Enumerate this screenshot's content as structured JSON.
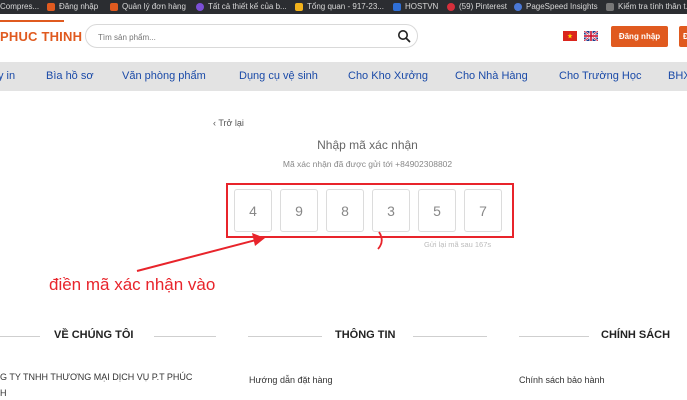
{
  "bookmarks": [
    {
      "label": "Compres...",
      "color": "#555555"
    },
    {
      "label": "Đăng nhập",
      "color": "#e05a1f"
    },
    {
      "label": "Quản lý đơn hàng",
      "color": "#e05a1f"
    },
    {
      "label": "Tất cả thiết kế của b...",
      "color": "#7b4fd6"
    },
    {
      "label": "Tổng quan - 917-23...",
      "color": "#f2b21b"
    },
    {
      "label": "HOSTVN",
      "color": "#2f6fd6"
    },
    {
      "label": "(59) Pinterest",
      "color": "#d62f3b"
    },
    {
      "label": "PageSpeed Insights",
      "color": "#4a78d6"
    },
    {
      "label": "Kiểm tra tính thân t...",
      "color": "#333333"
    }
  ],
  "header": {
    "logo": "PHUC THINH",
    "search_placeholder": "Tìm sản phẩm...",
    "login_label": "Đăng nhập",
    "login_label_2": "Đ",
    "accent": "#e05a1f"
  },
  "nav": {
    "items": [
      "y in",
      "Bìa hồ sơ",
      "Văn phòng phẩm",
      "Dụng cụ vệ sinh",
      "Cho Kho Xưởng",
      "Cho Nhà Hàng",
      "Cho Trường Học",
      "BHX"
    ]
  },
  "otp": {
    "back_label": "Trở lại",
    "title": "Nhập mã xác nhận",
    "subtitle": "Mã xác nhận đã được gửi tới +84902308802",
    "digits": [
      "4",
      "9",
      "8",
      "3",
      "5",
      "7"
    ],
    "resend": "Gửi lại mã sau 167s"
  },
  "annotation": {
    "text": "điền mã xác nhận vào",
    "color": "#e8242b"
  },
  "footer": {
    "sections": [
      "VỀ CHÚNG TÔI",
      "THÔNG TIN",
      "CHÍNH SÁCH"
    ],
    "company_line1": "G TY TNHH THƯƠNG MẠI DỊCH VỤ P.T PHÚC",
    "company_line2": "H",
    "info_link": "Hướng dẫn đặt hàng",
    "policy_link": "Chính sách bảo hành"
  }
}
